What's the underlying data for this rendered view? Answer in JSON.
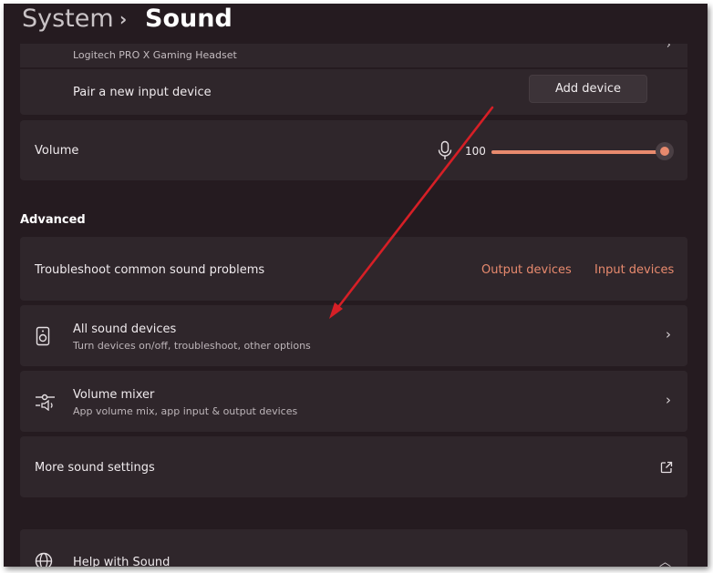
{
  "breadcrumb": {
    "parent": "System",
    "separator": "›",
    "current": "Sound"
  },
  "input_device": {
    "name": "Logitech PRO X Gaming Headset"
  },
  "pair_row": {
    "label": "Pair a new input device",
    "button": "Add device"
  },
  "volume_row": {
    "label": "Volume",
    "value": "100",
    "level": 100
  },
  "advanced": {
    "title": "Advanced",
    "troubleshoot": {
      "label": "Troubleshoot common sound problems",
      "output_link": "Output devices",
      "input_link": "Input devices"
    },
    "all_sound_devices": {
      "title": "All sound devices",
      "subtitle": "Turn devices on/off, troubleshoot, other options"
    },
    "volume_mixer": {
      "title": "Volume mixer",
      "subtitle": "App volume mix, app input & output devices"
    },
    "more_settings": {
      "label": "More sound settings"
    }
  },
  "help": {
    "title": "Help with Sound"
  },
  "colors": {
    "accent": "#e88a6e",
    "background": "#251b20",
    "card": "#2f262b",
    "annotation_arrow": "#d61f26"
  },
  "icons": [
    "chevron-right-icon",
    "microphone-icon",
    "speaker-icon",
    "mixer-icon",
    "external-link-icon",
    "globe-icon",
    "chevron-up-icon"
  ]
}
